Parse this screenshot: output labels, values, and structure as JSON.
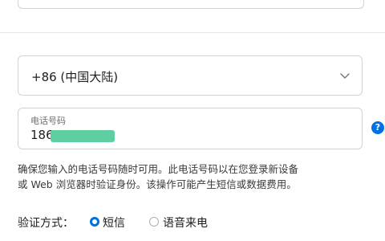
{
  "country_select": {
    "value": "+86 (中国大陆)",
    "icon": "chevron-down-icon"
  },
  "phone": {
    "label": "电话号码",
    "value_prefix": "186",
    "help_icon": "?"
  },
  "hint": {
    "line1": "确保您输入的电话号码随时可用。此电话号码以在您登录新设备",
    "line2": "或 Web 浏览器时验证身份。该操作可能产生短信或数据费用。"
  },
  "verification": {
    "label": "验证方式：",
    "options": [
      {
        "label": "短信",
        "selected": true
      },
      {
        "label": "语音来电",
        "selected": false
      }
    ]
  },
  "colors": {
    "accent": "#0071e3",
    "redaction": "#5fcfa1"
  }
}
